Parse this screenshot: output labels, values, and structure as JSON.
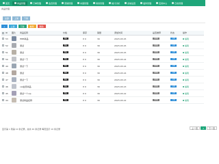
{
  "nav": {
    "tabs": [
      {
        "label": "首页",
        "active": false
      },
      {
        "label": "商品管理",
        "active": true
      },
      {
        "label": "订单管理",
        "active": false
      },
      {
        "label": "会员管理",
        "active": false
      },
      {
        "label": "营销管理",
        "active": false
      },
      {
        "label": "内容管理",
        "active": false
      },
      {
        "label": "财务管理",
        "active": false
      },
      {
        "label": "统计分析",
        "active": false
      },
      {
        "label": "系统设置",
        "active": false
      },
      {
        "label": "插件管理",
        "active": false
      },
      {
        "label": "应用中心",
        "active": false
      },
      {
        "label": "日志管理",
        "active": false
      }
    ]
  },
  "breadcrumb": "商品管理",
  "filters": [
    "全部",
    "上架",
    "下架"
  ],
  "actions": [
    {
      "label": "+",
      "color": "#2f8fd8"
    },
    {
      "label": "上架",
      "color": "#3aa7d8"
    },
    {
      "label": "下架",
      "color": "#27a278"
    },
    {
      "label": "推荐",
      "color": "#f0a830"
    },
    {
      "label": "删除",
      "color": "#e2554c"
    }
  ],
  "table": {
    "headers": {
      "id": "ID",
      "image": "图片",
      "name": "商品名称",
      "price": "价格",
      "stock": "库存",
      "sales": "销量",
      "time": "添加时间",
      "recommend": "是否推荐",
      "status": "状态",
      "op": "操作"
    },
    "rows": [
      {
        "id": "53",
        "name": "HBB商品",
        "price": "精品",
        "stock": "¥ 0",
        "sales": "30",
        "time": "2023-03-15",
        "recommend": "未推荐",
        "status": "上架",
        "op": "编辑"
      },
      {
        "id": "52",
        "name": "测试",
        "price": "精品",
        "stock": "¥ 0",
        "sales": "30",
        "time": "2023-03-15",
        "recommend": "未推荐",
        "status": "上架",
        "op": "编辑"
      },
      {
        "id": "51",
        "name": "测试",
        "price": "精品",
        "stock": "¥ 0",
        "sales": "30",
        "time": "2023-03-15",
        "recommend": "未推荐",
        "status": "上架",
        "op": "编辑"
      },
      {
        "id": "50",
        "name": "测试一下",
        "price": "精品",
        "stock": "¥ 0",
        "sales": "30",
        "time": "2023-03-14",
        "recommend": "未推荐",
        "status": "上架",
        "op": "编辑"
      },
      {
        "id": "49",
        "name": "测试一下",
        "price": "精品",
        "stock": "¥ 0",
        "sales": "30",
        "time": "2023-03-14",
        "recommend": "未推荐",
        "status": "上架",
        "op": "编辑"
      },
      {
        "id": "48",
        "name": "测试",
        "price": "精品",
        "stock": "¥ 0",
        "sales": "30",
        "time": "2023-03-14",
        "recommend": "未推荐",
        "status": "上架",
        "op": "编辑"
      },
      {
        "id": "47",
        "name": "测试一下",
        "price": "精品",
        "stock": "¥ 0",
        "sales": "30",
        "time": "2023-03-13",
        "recommend": "未推荐",
        "status": "上架",
        "op": "编辑"
      },
      {
        "id": "46",
        "name": "vip会员商品",
        "price": "精品",
        "stock": "¥ 0",
        "sales": "30",
        "time": "2023-03-13",
        "recommend": "未推荐",
        "status": "上架",
        "op": "编辑"
      },
      {
        "id": "45",
        "name": "测试一个vip",
        "price": "精品",
        "stock": "¥ 0",
        "sales": "30",
        "time": "2023-03-12",
        "recommend": "未推荐",
        "status": "上架",
        "op": "编辑"
      },
      {
        "id": "44",
        "name": "测试商品名称",
        "price": "精品",
        "stock": "¥ 0",
        "sales": "30",
        "time": "2023-03-12",
        "recommend": "未推荐",
        "status": "上架",
        "op": "编辑"
      }
    ]
  },
  "footer": "显示第 1 到第 10 条记录，总共 20 条记录 每页显示 10 条记录",
  "pager": [
    "上一页",
    "1",
    "下一页"
  ]
}
